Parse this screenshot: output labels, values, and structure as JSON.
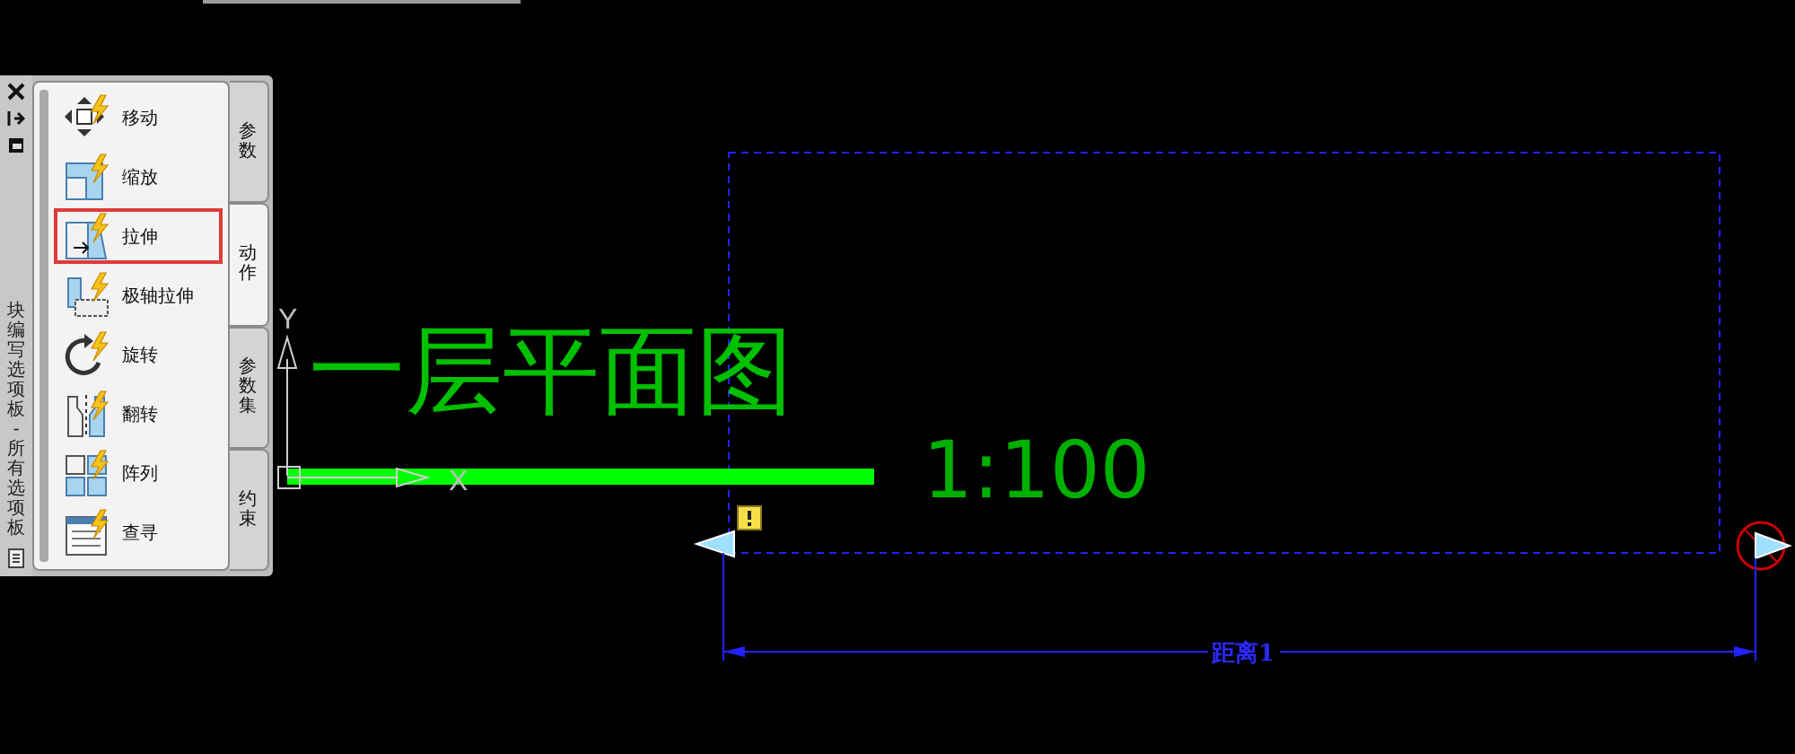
{
  "palette": {
    "title": "块编写选项板 - 所有选项板",
    "tabs": [
      {
        "label": "参数",
        "selected": false
      },
      {
        "label": "动作",
        "selected": true
      },
      {
        "label": "参数集",
        "selected": false
      },
      {
        "label": "约束",
        "selected": false
      }
    ],
    "items": [
      {
        "label": "移动",
        "selected": false
      },
      {
        "label": "缩放",
        "selected": false
      },
      {
        "label": "拉伸",
        "selected": true
      },
      {
        "label": "极轴拉伸",
        "selected": false
      },
      {
        "label": "旋转",
        "selected": false
      },
      {
        "label": "翻转",
        "selected": false
      },
      {
        "label": "阵列",
        "selected": false
      },
      {
        "label": "查寻",
        "selected": false
      }
    ]
  },
  "drawing": {
    "title": "一层平面图",
    "scale": "1:100",
    "axis_y": "Y",
    "axis_x": "X",
    "dimension_label": "距离1"
  }
}
